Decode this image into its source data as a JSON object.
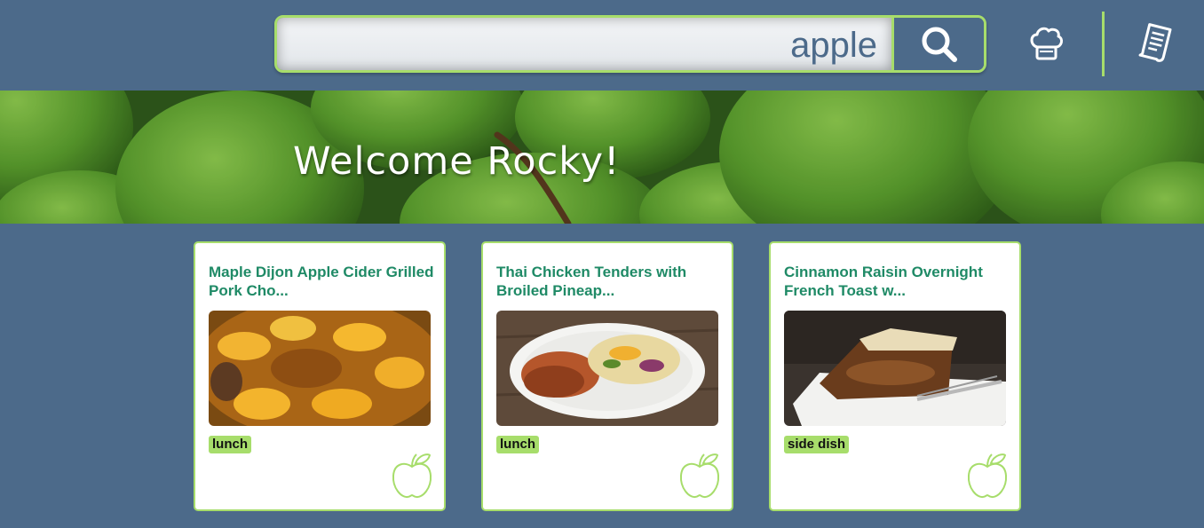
{
  "header": {
    "search": {
      "value": "apple",
      "placeholder": ""
    },
    "icons": {
      "search": "search-icon",
      "chef": "chef-hat-icon",
      "list": "recipe-list-icon"
    },
    "accent_color": "#a7dd6b",
    "background_color": "#4c6a8a"
  },
  "hero": {
    "welcome_text": "Welcome Rocky!"
  },
  "recipes": [
    {
      "title": "Maple Dijon Apple Cider Grilled Pork Cho...",
      "tag": "lunch",
      "icon": "apple-icon"
    },
    {
      "title": "Thai Chicken Tenders with Broiled Pineap...",
      "tag": "lunch",
      "icon": "apple-icon"
    },
    {
      "title": "Cinnamon Raisin Overnight French Toast w...",
      "tag": "side dish",
      "icon": "apple-icon"
    }
  ],
  "colors": {
    "title_green": "#1f8a66",
    "tag_green": "#a7dd6b"
  }
}
